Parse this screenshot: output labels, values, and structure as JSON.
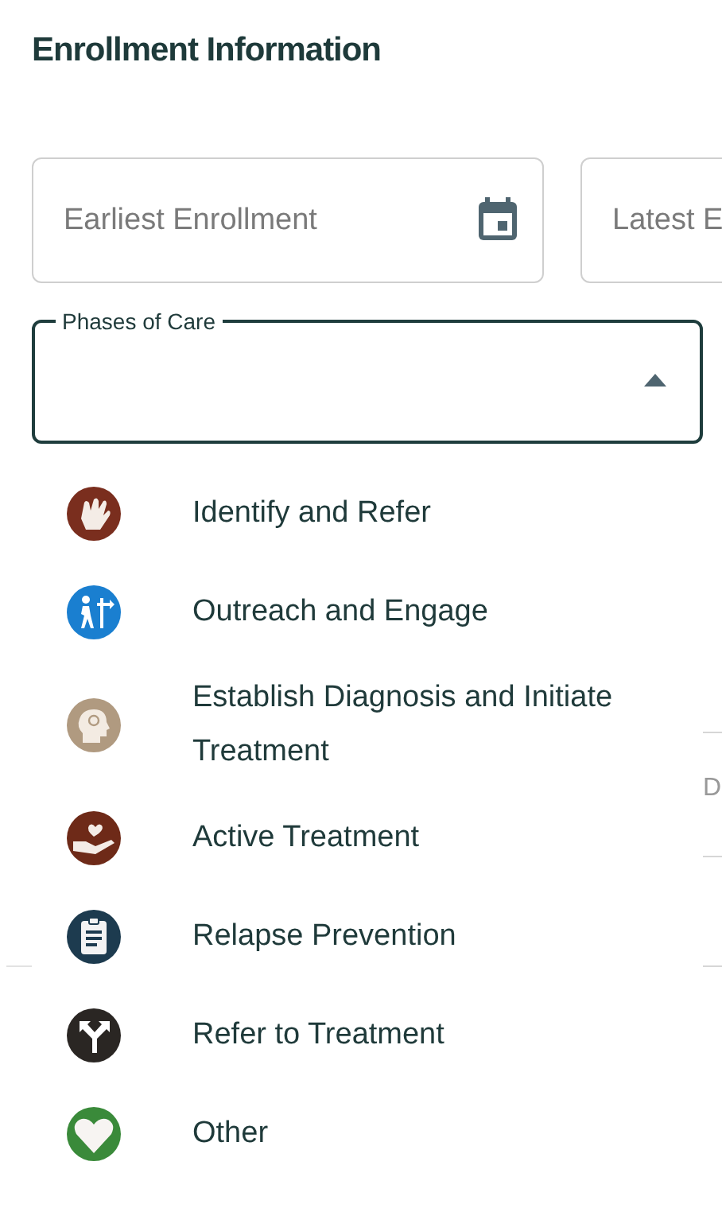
{
  "section_title": "Enrollment Information",
  "date_fields": [
    {
      "placeholder": "Earliest Enrollment"
    },
    {
      "placeholder": "Latest E"
    }
  ],
  "phases_select": {
    "label": "Phases of Care",
    "expanded": true
  },
  "background_text": "D",
  "phases_menu": [
    {
      "kind": "hand",
      "label": "Identify and Refer"
    },
    {
      "kind": "walker",
      "label": "Outreach and Engage"
    },
    {
      "kind": "head",
      "label": "Establish Diagnosis and Initiate Treatment"
    },
    {
      "kind": "care",
      "label": "Active Treatment"
    },
    {
      "kind": "clipboard",
      "label": "Relapse Prevention"
    },
    {
      "kind": "fork",
      "label": "Refer to Treatment"
    },
    {
      "kind": "heart",
      "label": "Other"
    }
  ]
}
